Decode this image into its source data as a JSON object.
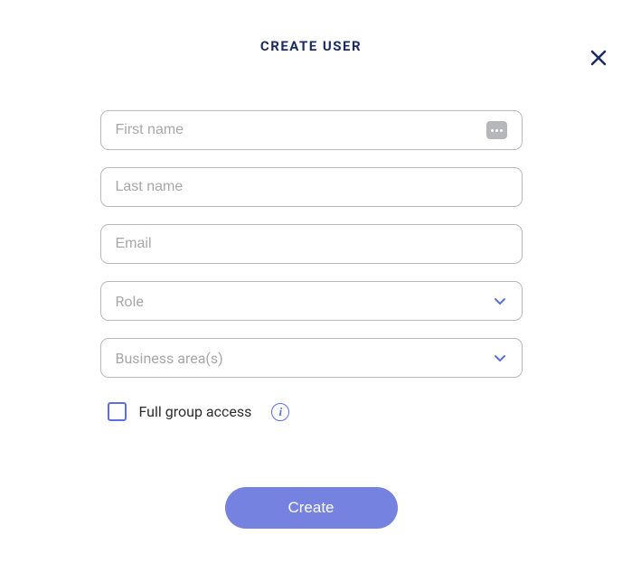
{
  "title": "CREATE USER",
  "fields": {
    "first_name": {
      "placeholder": "First name",
      "value": ""
    },
    "last_name": {
      "placeholder": "Last name",
      "value": ""
    },
    "email": {
      "placeholder": "Email",
      "value": ""
    },
    "role": {
      "placeholder": "Role",
      "value": ""
    },
    "business_areas": {
      "placeholder": "Business area(s)",
      "value": ""
    }
  },
  "checkbox": {
    "label": "Full group access",
    "checked": false
  },
  "info_glyph": "i",
  "submit_label": "Create"
}
